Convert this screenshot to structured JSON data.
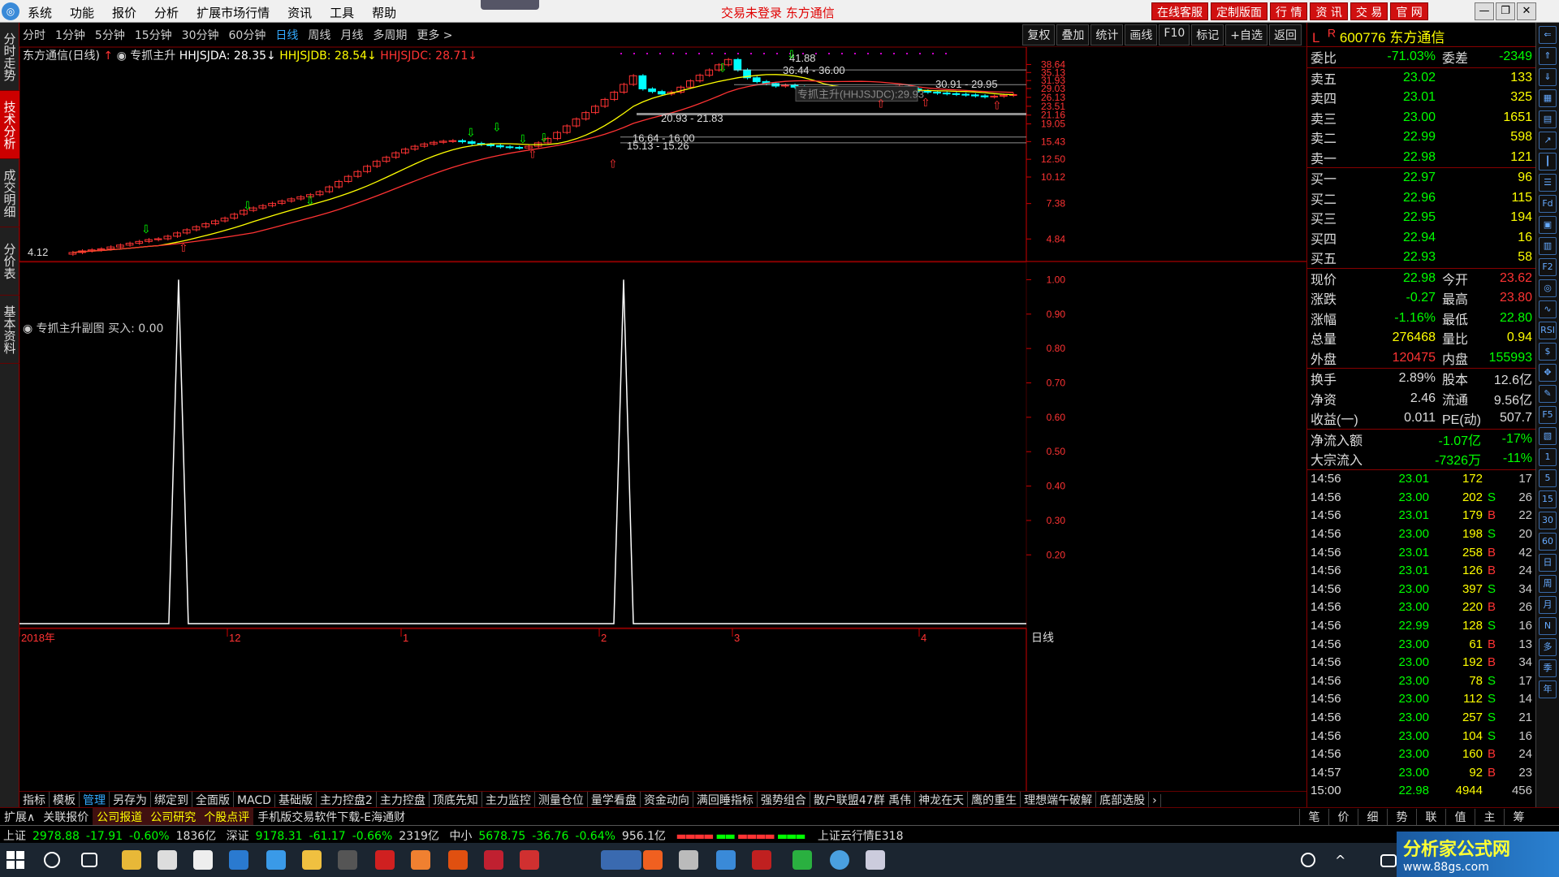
{
  "menu": {
    "items": [
      "系统",
      "功能",
      "报价",
      "分析",
      "扩展市场行情",
      "资讯",
      "工具",
      "帮助"
    ],
    "status": "交易未登录 东方通信",
    "rbtns": [
      "在线客服",
      "定制版面",
      "行 情",
      "资 讯",
      "交 易",
      "官 网"
    ]
  },
  "lefttabs": [
    "分时走势",
    "技术分析",
    "成交明细",
    "分价表",
    "基本资料"
  ],
  "periods": [
    "分时",
    "1分钟",
    "5分钟",
    "15分钟",
    "30分钟",
    "60分钟",
    "日线",
    "周线",
    "月线",
    "多周期",
    "更多 >"
  ],
  "tools": [
    "复权",
    "叠加",
    "统计",
    "画线",
    "F10",
    "标记",
    "+自选",
    "返回"
  ],
  "legend": {
    "name": "东方通信(日线)",
    "indicator": "专抓主升",
    "a": "HHJSJDA: 28.35",
    "b": "HHJSJDB: 28.54",
    "c": "HHJSJDC: 28.71"
  },
  "panel2": {
    "title": "专抓主升副图  买入: 0.00"
  },
  "stock": {
    "code": "600776",
    "name": "东方通信",
    "flag": "L",
    "r": "R"
  },
  "wb": [
    {
      "l": "委比",
      "v1": "-71.03%",
      "l2": "委差",
      "v2": "-2349"
    }
  ],
  "sells": [
    {
      "l": "卖五",
      "p": "23.02",
      "v": "133"
    },
    {
      "l": "卖四",
      "p": "23.01",
      "v": "325"
    },
    {
      "l": "卖三",
      "p": "23.00",
      "v": "1651"
    },
    {
      "l": "卖二",
      "p": "22.99",
      "v": "598"
    },
    {
      "l": "卖一",
      "p": "22.98",
      "v": "121"
    }
  ],
  "buys": [
    {
      "l": "买一",
      "p": "22.97",
      "v": "96"
    },
    {
      "l": "买二",
      "p": "22.96",
      "v": "115"
    },
    {
      "l": "买三",
      "p": "22.95",
      "v": "194"
    },
    {
      "l": "买四",
      "p": "22.94",
      "v": "16"
    },
    {
      "l": "买五",
      "p": "22.93",
      "v": "58"
    }
  ],
  "quote": [
    {
      "l1": "现价",
      "v1": "22.98",
      "l2": "今开",
      "v2": "23.62"
    },
    {
      "l1": "涨跌",
      "v1": "-0.27",
      "l2": "最高",
      "v2": "23.80"
    },
    {
      "l1": "涨幅",
      "v1": "-1.16%",
      "l2": "最低",
      "v2": "22.80"
    },
    {
      "l1": "总量",
      "v1": "276468",
      "l2": "量比",
      "v2": "0.94"
    },
    {
      "l1": "外盘",
      "v1": "120475",
      "l2": "内盘",
      "v2": "155993"
    }
  ],
  "fund": [
    {
      "l1": "换手",
      "v1": "2.89%",
      "l2": "股本",
      "v2": "12.6亿"
    },
    {
      "l1": "净资",
      "v1": "2.46",
      "l2": "流通",
      "v2": "9.56亿"
    },
    {
      "l1": "收益(一)",
      "v1": "0.011",
      "l2": "PE(动)",
      "v2": "507.7"
    }
  ],
  "flow": [
    {
      "l": "净流入额",
      "v": "-1.07亿",
      "p": "-17%"
    },
    {
      "l": "大宗流入",
      "v": "-7326万",
      "p": "-11%"
    }
  ],
  "ticks": [
    [
      "14:56",
      "23.01",
      "172",
      "",
      "17"
    ],
    [
      "14:56",
      "23.00",
      "202",
      "S",
      "26"
    ],
    [
      "14:56",
      "23.01",
      "179",
      "B",
      "22"
    ],
    [
      "14:56",
      "23.00",
      "198",
      "S",
      "20"
    ],
    [
      "14:56",
      "23.01",
      "258",
      "B",
      "42"
    ],
    [
      "14:56",
      "23.01",
      "126",
      "B",
      "24"
    ],
    [
      "14:56",
      "23.00",
      "397",
      "S",
      "34"
    ],
    [
      "14:56",
      "23.00",
      "220",
      "B",
      "26"
    ],
    [
      "14:56",
      "22.99",
      "128",
      "S",
      "16"
    ],
    [
      "14:56",
      "23.00",
      "61",
      "B",
      "13"
    ],
    [
      "14:56",
      "23.00",
      "192",
      "B",
      "34"
    ],
    [
      "14:56",
      "23.00",
      "78",
      "S",
      "17"
    ],
    [
      "14:56",
      "23.00",
      "112",
      "S",
      "14"
    ],
    [
      "14:56",
      "23.00",
      "257",
      "S",
      "21"
    ],
    [
      "14:56",
      "23.00",
      "104",
      "S",
      "16"
    ],
    [
      "14:56",
      "23.00",
      "160",
      "B",
      "24"
    ],
    [
      "14:57",
      "23.00",
      "92",
      "B",
      "23"
    ],
    [
      "15:00",
      "22.98",
      "4944",
      "",
      "456"
    ]
  ],
  "indtabs": [
    "指标",
    "模板",
    "管理",
    "另存为",
    "绑定到",
    "全面版",
    "MACD",
    "基础版",
    "主力控盘2",
    "主力控盘",
    "顶底先知",
    "主力监控",
    "测量仓位",
    "量学看盘",
    "资金动向",
    "满回睡指标",
    "强势组合",
    "散户联盟47群 禹伟",
    "神龙在天",
    "鹰的重生",
    "理想端午破解",
    "底部选股"
  ],
  "infobar": [
    "扩展∧",
    "关联报价",
    "公司报道",
    "公司研究",
    "个股点评",
    "手机版交易软件下载-E海通财"
  ],
  "rtabs": [
    "笔",
    "价",
    "细",
    "势",
    "联",
    "值",
    "主",
    "筹"
  ],
  "index": {
    "sh": "上证",
    "shv": "2978.88",
    "shc": "-17.91",
    "shp": "-0.60%",
    "sha": "1836亿",
    "sz": "深证",
    "szv": "9178.31",
    "szc": "-61.17",
    "szp": "-0.66%",
    "sza": "2319亿",
    "zx": "中小",
    "zxv": "5678.75",
    "zxc": "-36.76",
    "zxp": "-0.64%",
    "zxa": "956.1亿",
    "news": "上证云行情E318"
  },
  "chart_data": {
    "type": "candlestick",
    "y_ticks": [
      "38.64",
      "35.13",
      "31.93",
      "29.03",
      "26.13",
      "23.51",
      "21.16",
      "19.05",
      "15.43",
      "12.50",
      "10.12",
      "7.38",
      "4.84"
    ],
    "annotations": [
      "41.88",
      "36.44 - 36.00",
      "30.91 - 29.95",
      "20.93 - 21.83",
      "16.64 - 16.00",
      "15.13 - 15.26",
      "4.12",
      "专抓主升(HHJSJDC):29.93"
    ],
    "x_labels": [
      "2018年",
      "12",
      "1",
      "2",
      "3",
      "4"
    ],
    "period_label": "日线",
    "sub_y_ticks": [
      "1.00",
      "0.90",
      "0.80",
      "0.70",
      "0.60",
      "0.50",
      "0.40",
      "0.30",
      "0.20"
    ],
    "sub_signals": [
      {
        "x_frac": 0.158,
        "value": 1.0
      },
      {
        "x_frac": 0.6,
        "value": 1.0
      }
    ],
    "closes": [
      4.12,
      4.2,
      4.25,
      4.3,
      4.4,
      4.5,
      4.6,
      4.7,
      4.8,
      4.85,
      5.0,
      5.2,
      5.4,
      5.6,
      5.8,
      6.0,
      6.2,
      6.5,
      6.8,
      7.0,
      7.2,
      7.4,
      7.6,
      7.8,
      8.0,
      8.2,
      8.5,
      9.0,
      9.6,
      10.2,
      10.8,
      11.5,
      12.2,
      12.8,
      13.5,
      14.1,
      14.6,
      15.0,
      15.3,
      15.5,
      15.6,
      15.4,
      15.1,
      14.9,
      14.7,
      14.5,
      14.4,
      14.3,
      14.6,
      15.2,
      16.0,
      17.2,
      18.6,
      20.2,
      21.8,
      23.5,
      25.5,
      27.8,
      30.5,
      33.8,
      28.9,
      28.0,
      27.2,
      27.8,
      29.5,
      31.8,
      34.0,
      36.2,
      38.5,
      41.0,
      36.2,
      33.0,
      31.5,
      30.8,
      29.9,
      30.2,
      29.5,
      29.0,
      28.6,
      29.1,
      28.4,
      28.8,
      27.9,
      28.3,
      27.6,
      28.0,
      28.5,
      29.8,
      28.9,
      28.2,
      27.8,
      27.5,
      27.3,
      27.1,
      26.9,
      26.6,
      26.3,
      26.5,
      26.8,
      27.0
    ]
  }
}
